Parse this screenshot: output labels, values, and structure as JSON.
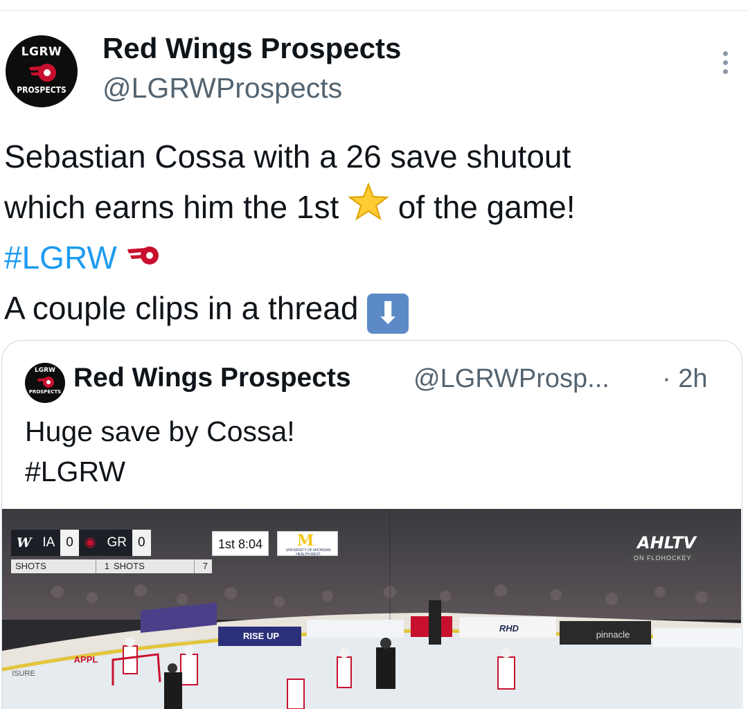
{
  "tweet": {
    "avatar_top": "LGRW",
    "avatar_bottom": "PROSPECTS",
    "display_name": "Red Wings Prospects",
    "handle": "@LGRWProspects",
    "more_icon": "more-vertical-icon",
    "text_line1": "Sebastian Cossa with a 26 save shutout",
    "text_line2_a": "which earns him the 1st",
    "text_line2_b": "of the game!",
    "hashtag": "#LGRW",
    "text_line4": "A couple clips in a thread",
    "hashtag_color": "#1d9bf0"
  },
  "quoted": {
    "avatar_top": "LGRW",
    "avatar_bottom": "PROSPECTS",
    "display_name": "Red Wings Prospects",
    "handle": "@LGRWProsp...",
    "time": "· 2h",
    "text_line1": "Huge save by Cossa!",
    "text_line2": "#LGRW"
  },
  "video": {
    "team1": "IA",
    "score1": "0",
    "team2": "GR",
    "score2": "0",
    "period_clock": "1st  8:04",
    "shots_label": "SHOTS",
    "shots1": "1",
    "shots2": "7",
    "sponsor_letter": "M",
    "sponsor_text": "UNIVERSITY OF MICHIGAN HEALTH-WEST",
    "broadcaster": "AHLTV",
    "broadcaster_sub": "ON FLOHOCKEY",
    "boards": [
      "RISE UP",
      "RHD",
      "pinnacle",
      "APPL",
      "ISURE"
    ]
  }
}
